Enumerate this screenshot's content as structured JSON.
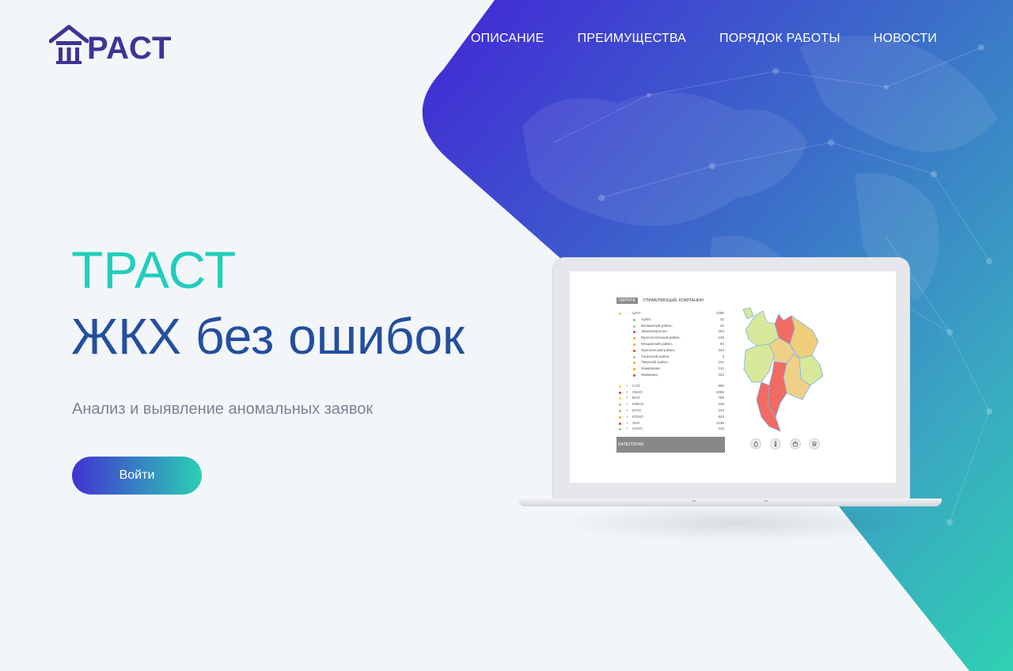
{
  "brand": {
    "logo_text": "РАСТ"
  },
  "nav": {
    "items": [
      {
        "label": "ОПИСАНИЕ"
      },
      {
        "label": "ПРЕИМУЩЕСТВА"
      },
      {
        "label": "ПОРЯДОК РАБОТЫ"
      },
      {
        "label": "НОВОСТИ"
      }
    ]
  },
  "hero": {
    "title": "ТРАСТ",
    "tagline": "ЖКХ без ошибок",
    "subtitle": "Анализ и выявление аномальных заявок",
    "login_label": "Войти"
  },
  "colors": {
    "brand_teal": "#22cdbc",
    "brand_blue": "#244f9e",
    "gradient_start": "#4232d2",
    "gradient_end": "#2bcfb4",
    "status_red": "#e53935",
    "status_orange": "#f5a623",
    "status_yellow": "#f2d12a",
    "status_green": "#8bd36b"
  },
  "screen": {
    "tabs": [
      {
        "label": "ОКРУГА",
        "active": true
      },
      {
        "label": "УПРАВЛЯЮЩИЕ КОМПАНИИ",
        "active": false
      }
    ],
    "district_toggle": "-",
    "district_name": "ЦАО",
    "district_value": "1386",
    "subrows": [
      {
        "name": "Арбат,",
        "value": "32",
        "status": "green"
      },
      {
        "name": "Басманный район,",
        "value": "43",
        "status": "green"
      },
      {
        "name": "Замоскворечье,",
        "value": "153",
        "status": "red"
      },
      {
        "name": "Красносельский район,",
        "value": "125",
        "status": "orange"
      },
      {
        "name": "Мещанский район,",
        "value": "83",
        "status": "orange"
      },
      {
        "name": "Пресненский район,",
        "value": "233",
        "status": "red"
      },
      {
        "name": "Таганский район,",
        "value": "3",
        "status": "green"
      },
      {
        "name": "Тверской район,",
        "value": "151",
        "status": "orange"
      },
      {
        "name": "Хамовники,",
        "value": "131",
        "status": "orange"
      },
      {
        "name": "Якиманка,",
        "value": "434",
        "status": "red"
      }
    ],
    "districts": [
      {
        "name": "САО",
        "value": "980",
        "status": "yellow"
      },
      {
        "name": "СВАО",
        "value": "2365",
        "status": "red"
      },
      {
        "name": "ВАО",
        "value": "785",
        "status": "yellow"
      },
      {
        "name": "ЮВАО",
        "value": "235",
        "status": "green"
      },
      {
        "name": "ЮАО",
        "value": "234",
        "status": "green"
      },
      {
        "name": "ЮЗАО",
        "value": "823",
        "status": "orange"
      },
      {
        "name": "ЗАО",
        "value": "1238",
        "status": "red"
      },
      {
        "name": "СЗАО",
        "value": "123",
        "status": "green"
      }
    ],
    "category_label": "КАТЕГОРИЯ",
    "category_icons": [
      "water-drop-icon",
      "thermometer-icon",
      "basket-icon",
      "building-icon"
    ]
  }
}
